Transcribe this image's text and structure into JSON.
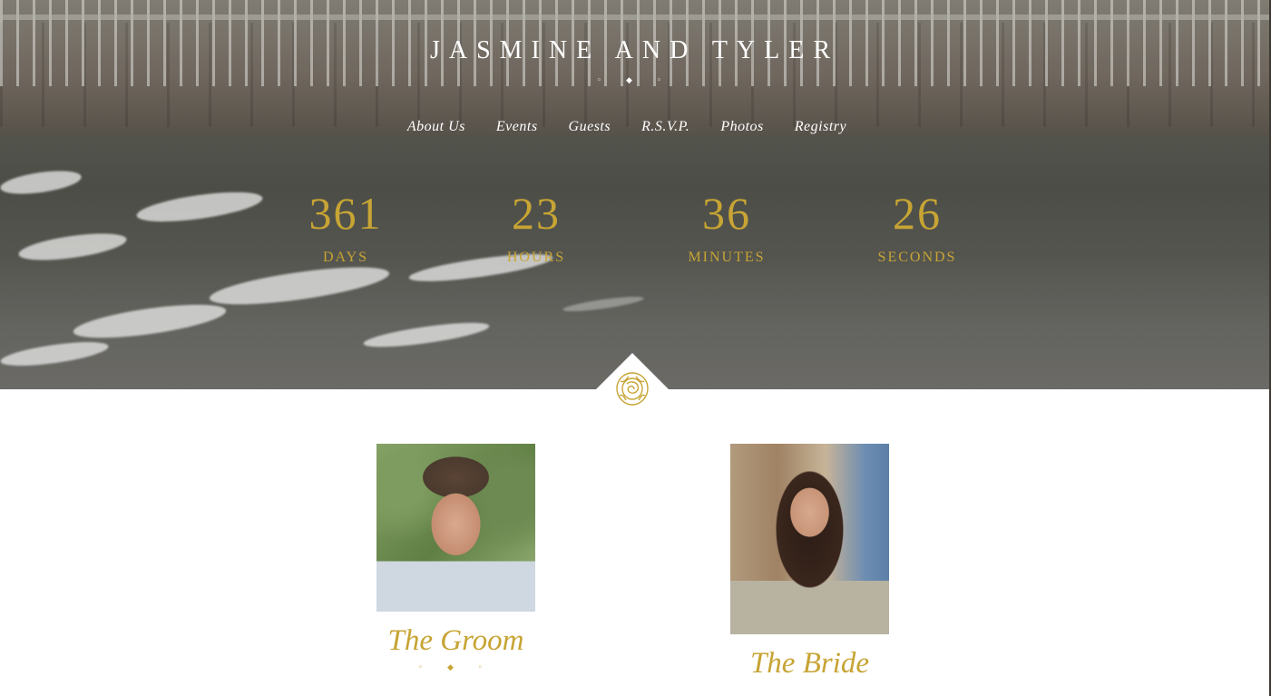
{
  "header": {
    "site_title": "JASMINE AND TYLER",
    "ornament": "◦ ◆ ◦"
  },
  "nav": {
    "items": [
      "About Us",
      "Events",
      "Guests",
      "R.S.V.P.",
      "Photos",
      "Registry"
    ]
  },
  "countdown": {
    "days": {
      "value": "361",
      "label": "DAYS"
    },
    "hours": {
      "value": "23",
      "label": "HOURS"
    },
    "minutes": {
      "value": "36",
      "label": "MINUTES"
    },
    "seconds": {
      "value": "26",
      "label": "SECONDS"
    }
  },
  "couple": {
    "groom": {
      "title": "The Groom",
      "ornament": "◦ ◆ ◦"
    },
    "bride": {
      "title": "The Bride"
    }
  },
  "colors": {
    "accent_gold": "#c7a434",
    "title_white": "#ffffff",
    "background": "#ffffff"
  },
  "icons": {
    "badge": "rose-icon"
  }
}
